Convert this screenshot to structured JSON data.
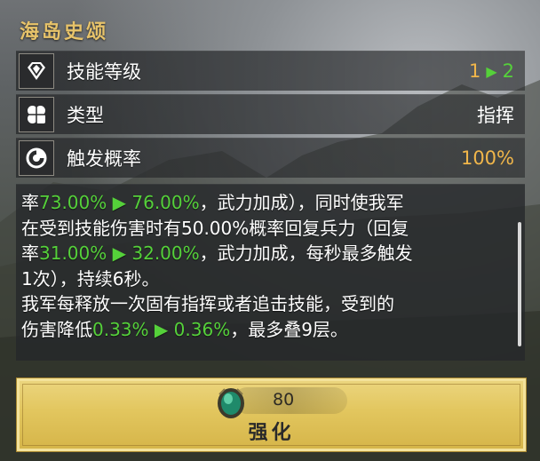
{
  "skill": {
    "title": "海岛史颂"
  },
  "stats": [
    {
      "icon": "diamond-icon",
      "label": "技能等级",
      "value_from": "1",
      "value_to": "2"
    },
    {
      "icon": "clover-icon",
      "label": "类型",
      "value": "指挥"
    },
    {
      "icon": "trigger-icon",
      "label": "触发概率",
      "value": "100%"
    }
  ],
  "description": {
    "l1_a": "率",
    "l1_n1": "73.00%",
    "l1_arrow": "▶",
    "l1_n2": "76.00%",
    "l1_b": "，武力加成），同时使我军",
    "l2": "在受到技能伤害时有50.00%概率回复兵力（回复",
    "l3_a": "率",
    "l3_n1": "31.00%",
    "l3_arrow": "▶",
    "l3_n2": "32.00%",
    "l3_b": "，武力加成，每秒最多触发",
    "l4": "1次），持续6秒。",
    "l5": "我军每释放一次固有指挥或者追击技能，受到的",
    "l6_a": "伤害降低",
    "l6_n1": "0.33%",
    "l6_arrow": "▶",
    "l6_n2": "0.36%",
    "l6_b": "，最多叠9层。"
  },
  "upgrade": {
    "cost_icon": "green-gem-icon",
    "cost": "80",
    "label": "强化"
  },
  "colors": {
    "title_gold": "#e7c36a",
    "value_gold": "#f1b64a",
    "increase_green": "#55d13a",
    "button_gold": "#e2c65e"
  }
}
